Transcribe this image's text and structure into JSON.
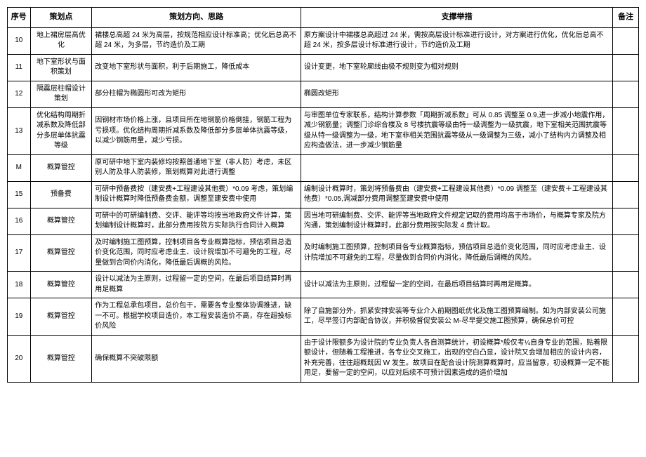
{
  "headers": {
    "seq": "序号",
    "point": "策划点",
    "direction": "策划方向、思路",
    "measure": "支撑举措",
    "remark": "备注"
  },
  "rows": [
    {
      "seq": "10",
      "point": "地上裙房层高优化",
      "direction": "裙楼总高超 24 米为高层，按规范相应设计标准高；优化后总高不超 24 米，为多层，节约造价及工期",
      "measure": "原方案设计中裙楼总高超过 24 米，需按高层设计标准进行设计，对方案进行优化，优化后总高不超 24 米，按多层设计标准进行设计，节约造价及工期",
      "remark": ""
    },
    {
      "seq": "11",
      "point": "地下室形状与面积策划",
      "direction": "改变地下室形状与面积，利于后期施工，降低成本",
      "measure": "设计变更，地下室轮廓线由极不规则变为相对规则",
      "remark": ""
    },
    {
      "seq": "12",
      "point": "隔震层柱帽设计策划",
      "direction": "部分柱帽为椭圆形可改为矩形",
      "measure": "椭圆改矩形",
      "remark": ""
    },
    {
      "seq": "13",
      "point": "优化结构周期折减系数及降低部分多层单体抗震等级",
      "direction": "因钢材市场价格上涨，且项目所在地钢筋价格倒挂，钢筋工程为亏损项。优化结构周期折减系数及降低部分多层单体抗震等级，以减少钢筋用量，减少亏损。",
      "measure": "与审图单位专家联系，结构计算参数「周期折减系数」可从 0.85 调整至 0.9,进一步减小地震作用，减少钢筋量；调整门诊综合楼及 8 号楼抗震等级由特一级调整为一级抗震，地下室相关范围抗震等级从特一级调整为一级，地下室非相关范围抗震等级从一级调整为三级，减小了结构内力调整及相应构造做法，进一步减少钢筋量",
      "remark": ""
    },
    {
      "seq": "M",
      "point": "概算管控",
      "direction": "原可研中地下室内装修均按照普通地下室（非人防）考虑，未区别人防及非人防装修，策划概算对此进行调整",
      "measure": "",
      "remark": ""
    },
    {
      "seq": "15",
      "point": "预备费",
      "direction": "可研中预备费按（建安费+工程建设其他费）*0.09 考虑，策划编制设计概算时降低预备费金额，调整至建安费中使用",
      "measure": "编制设计概算时，策划将预备费由（建安费+工程建设其他费）*0.09 调整至（建安费＋工程建设其他费）*0.05,调减部分费用调整至建安费中使用",
      "remark": ""
    },
    {
      "seq": "16",
      "point": "概算管控",
      "direction": "可研中的可研编制费、交评、能评等均按当地政府文件计算，策划编制设计概算时，此部分费用按院方实际执行合同计入概算",
      "measure": "因当地可研编制费、交评、能评等当地政府文件规定记取的费用均高于市场价，与概算专家及院方沟通，策划编制设计概算时，此部分费用按实际发 4 费计取。",
      "remark": ""
    },
    {
      "seq": "17",
      "point": "概算管控",
      "direction": "及时编制施工图预算，控制项目各专业概算指标，预估项目总造价变化范围，同时应考虑业主、设计院增加不可避免的工程，尽量做到合同价内消化，降低最后调概的风险。",
      "measure": "及时编制施工图预算，控制项目各专业概算指标，预估项目总造价变化范围，同时应考虑业主、设计院增加不可避免的工程，尽量做到合同价内消化，降低最后调概的风险。",
      "remark": ""
    },
    {
      "seq": "18",
      "point": "概算管控",
      "direction": "设计以减法为主原则，过程留一定的空间，在最后项目结算时再用足概算",
      "measure": "设计以减法为主原则，过程留一定的空间，在最后项目结算时再用足概算。",
      "remark": ""
    },
    {
      "seq": "19",
      "point": "概算管控",
      "direction": "作为工程总承包项目，总价包干，需要各专业整体协调推进，缺一不可。根据学校项目造价，本工程安装造价不高，存在超投标价风险",
      "measure": "除了自施部分外，抓紧安排安装等专业介入前期图纸优化及施工图预算编制。如为内部安装公司施工，尽早签订内部配合协议，并积极督促安装公 M-尽早提交施工图预算，确保总价可控",
      "remark": ""
    },
    {
      "seq": "20",
      "point": "概算管控",
      "direction": "确保概算不突破限额",
      "measure": "由于设计限额多为设计院的专业负责人各自测算统计，初设概算*般仅考¼自身专业的范围，贴着限额设计，但随着工程推进，各专业交叉施工，出现的空白凸显，设计院又会增加相应的设计内容，补充完善，往往超概既因 W 发生。故项目在配合设计院测算概算时，应当留意，初设概算一定不能用足，要留一定的空间，以应对后续不可预计因素造成的造价增加",
      "remark": ""
    }
  ]
}
